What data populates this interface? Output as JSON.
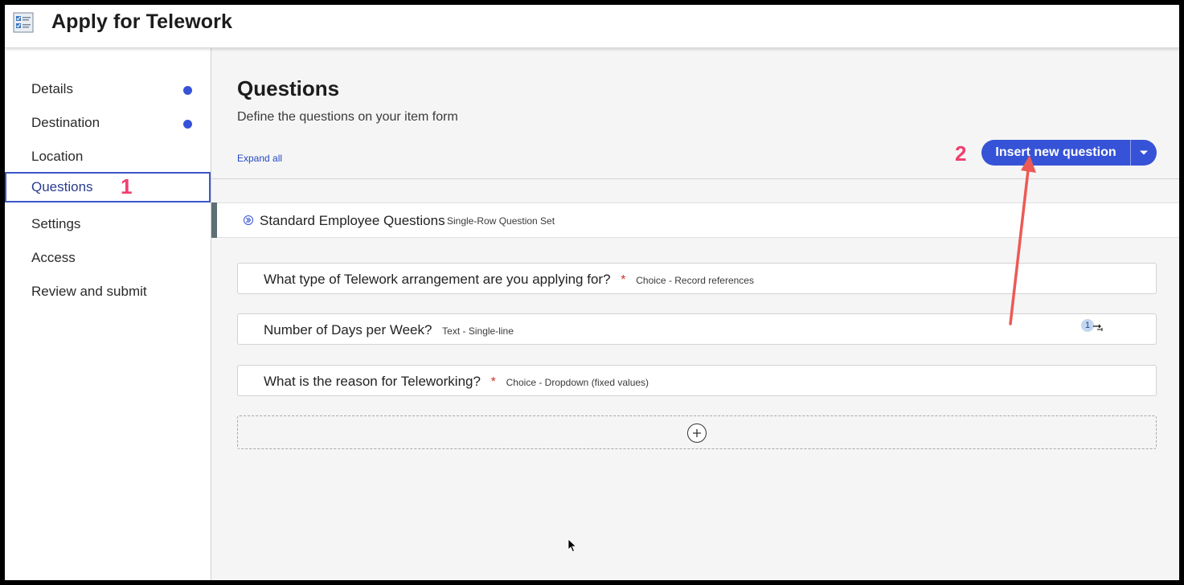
{
  "app": {
    "title": "Apply for Telework",
    "icon": "catalog-form-icon"
  },
  "sidebar": {
    "items": [
      {
        "label": "Details",
        "status": "incomplete"
      },
      {
        "label": "Destination",
        "status": "incomplete"
      },
      {
        "label": "Location",
        "status": ""
      },
      {
        "label": "Questions",
        "status": "active"
      },
      {
        "label": "Settings",
        "status": ""
      },
      {
        "label": "Access",
        "status": ""
      },
      {
        "label": "Review and submit",
        "status": ""
      }
    ]
  },
  "annotations": {
    "step1": "1",
    "step2": "2",
    "color": "#ef3e6d",
    "arrow_color": "#ec5a56"
  },
  "main": {
    "title": "Questions",
    "subtitle": "Define the questions on your item form",
    "expand_all": "Expand all",
    "insert_button": "Insert new question",
    "question_set": {
      "name": "Standard Employee Questions",
      "type": "Single-Row Question Set"
    },
    "questions": [
      {
        "text": "What type of Telework arrangement are you applying for?",
        "required": "*",
        "type": "Choice - Record references"
      },
      {
        "text": "Number of Days per Week?",
        "required": "",
        "type": "Text - Single-line",
        "badge": "1"
      },
      {
        "text": "What is the reason for Teleworking?",
        "required": "*",
        "type": "Choice - Dropdown (fixed values)"
      }
    ]
  },
  "colors": {
    "accent": "#3653d7",
    "required": "#d0342c",
    "link": "#2349c4"
  }
}
